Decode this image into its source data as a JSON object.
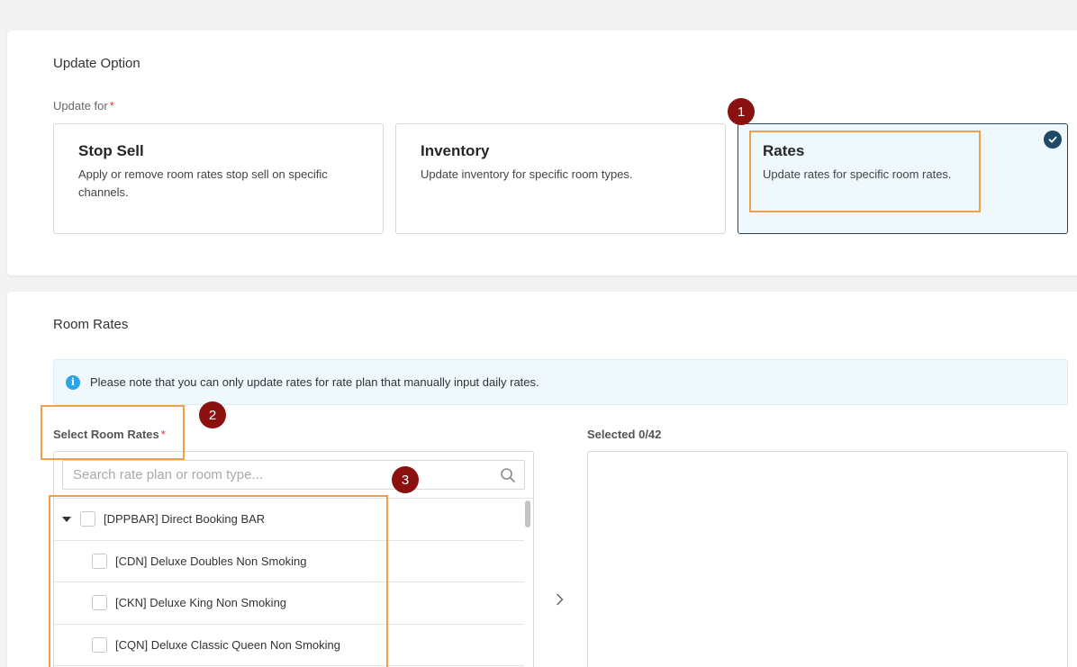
{
  "update_option": {
    "title": "Update Option",
    "update_for_label": "Update for",
    "required_mark": "*",
    "options": [
      {
        "title": "Stop Sell",
        "desc": "Apply or remove room rates stop sell on specific channels.",
        "selected": false
      },
      {
        "title": "Inventory",
        "desc": "Update inventory for specific room types.",
        "selected": false
      },
      {
        "title": "Rates",
        "desc": "Update rates for specific room rates.",
        "selected": true
      }
    ]
  },
  "room_rates": {
    "title": "Room Rates",
    "info_icon": "info-icon",
    "info_text": "Please note that you can only update rates for rate plan that manually input daily rates.",
    "select_label": "Select Room Rates",
    "required_mark": "*",
    "selected_label": "Selected 0/42",
    "search_placeholder": "Search rate plan or room type...",
    "items": [
      {
        "label": "[DPPBAR] Direct Booking BAR",
        "level": "parent",
        "expanded": true
      },
      {
        "label": "[CDN] Deluxe Doubles Non Smoking",
        "level": "child"
      },
      {
        "label": "[CKN] Deluxe King Non Smoking",
        "level": "child"
      },
      {
        "label": "[CQN] Deluxe Classic Queen Non Smoking",
        "level": "child"
      }
    ]
  },
  "annotations": {
    "badges": [
      "1",
      "2",
      "3"
    ],
    "highlight_color": "#f0a04b",
    "badge_color": "#8b1010"
  },
  "colors": {
    "selected_border": "#1f4a66",
    "selected_bg": "#eef8fd",
    "required": "#e5322d",
    "info_icon": "#2aa3e8"
  }
}
